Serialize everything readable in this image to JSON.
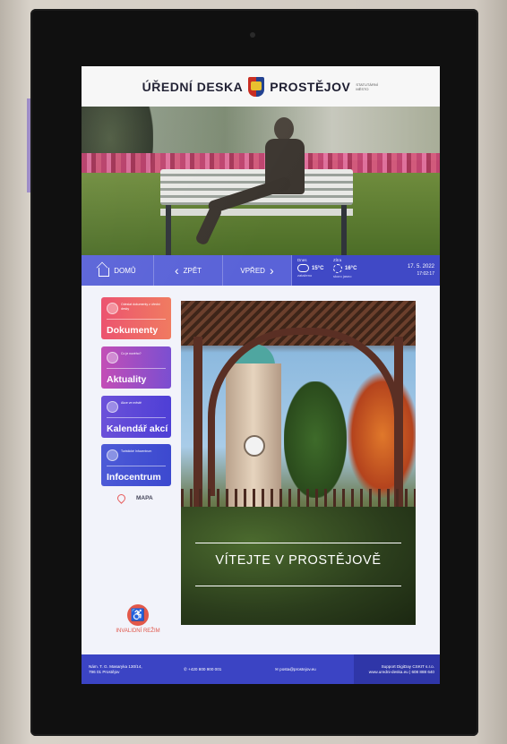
{
  "header": {
    "title_left": "ÚŘEDNÍ DESKA",
    "title_right": "PROSTĚJOV",
    "small_text": "STATUTÁRNÍ MĚSTO"
  },
  "nav": {
    "home_label": "DOMŮ",
    "back_label": "ZPĚT",
    "forward_label": "VPŘED"
  },
  "weather": {
    "today": {
      "day": "Dnes",
      "temp": "15°C",
      "desc": "zataženo",
      "icon": "cloud-icon"
    },
    "tomorrow": {
      "day": "Zítra",
      "temp": "16°C",
      "desc": "skoro jasno",
      "icon": "sun-icon"
    }
  },
  "datetime": {
    "date": "17. 5. 2022",
    "time": "17:02:17"
  },
  "tiles": [
    {
      "small": "Odeslat dokumenty z úřední desky",
      "label": "Dokumenty"
    },
    {
      "small": "Co je nového?",
      "label": "Aktuality"
    },
    {
      "small": "Akce ve městě",
      "label": "Kalendář akcí"
    },
    {
      "small": "Turistické Infocentrum",
      "label": "Infocentrum"
    }
  ],
  "map_label": "MAPA",
  "welcome": "VÍTEJTE V PROSTĚJOVĚ",
  "invalid_label": "INVALIDNÍ REŽIM",
  "footer": {
    "address_1": "Nám. T. G. Masaryka 130/14,",
    "address_2": "796 01 Prostějov",
    "phone": "+420 800 900 001",
    "email": "posta@prostejov.eu",
    "support_1": "Support DigiDay CSKIT s.r.o.",
    "support_2": "www.uredni-deska.eu | 608 888 640"
  },
  "colors": {
    "nav": "#5a63d8",
    "footer": "#3b44c4",
    "tile_documents": "#ec4f6c",
    "tile_news": "#c24bb5",
    "tile_calendar": "#6a4fd9",
    "tile_info": "#4c5ad7",
    "accent_red": "#e2584a"
  }
}
